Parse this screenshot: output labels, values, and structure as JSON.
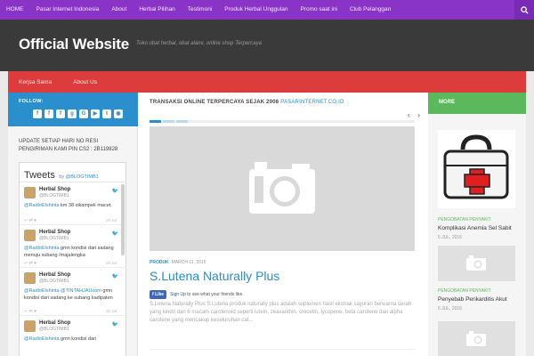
{
  "topnav": {
    "items": [
      "HOME",
      "Pasar Internet Indonesia",
      "About",
      "Herbal Pilihan",
      "Testimoni",
      "Produk Herbal Unggulan",
      "Promo saat ini",
      "Club Pelanggan"
    ]
  },
  "header": {
    "title": "Official Website",
    "tagline": "Toko obat herbal, obat alami, online shop Terpercaya"
  },
  "subnav": {
    "items": [
      "Kerjsa Sama",
      "About Us"
    ]
  },
  "left": {
    "follow_label": "FOLLOW:",
    "social_icons": [
      "facebook-icon",
      "facebook-icon",
      "facebook-icon",
      "google-plus-icon",
      "google-plus-icon",
      "youtube-icon",
      "twitter-icon",
      "rss-icon"
    ],
    "update_text": "UPDATE SETIAP HARI NO RESI PENGIRIMAN KAMI PIN CS2 : 2B119828",
    "tweets_title": "Tweets",
    "tweets_by": "by",
    "tweets_handle": "@BLOGTIMB1",
    "tweets": [
      {
        "name": "Herbal Shop",
        "handle": "@BLOGTIMB1",
        "mention": "@RadioElshinta",
        "text": " km 38 cikampek macet.",
        "time": "20 Jul"
      },
      {
        "name": "Herbal Shop",
        "handle": "@BLOGTIMB1",
        "mention": "@RadioElshinta",
        "text": " gmn kondisi dari sadang menuju subang /majalengka",
        "time": "20 Jul"
      },
      {
        "name": "Herbal Shop",
        "handle": "@BLOGTIMB1",
        "mention": "@RadioElshinta @TINTAHJAUcom",
        "text": " gmn kondisi dari sadang ke subang kadipaten",
        "time": "20 Jul"
      },
      {
        "name": "Herbal Shop",
        "handle": "@BLOGTIMB1",
        "mention": "@RadioElshinta",
        "text": " gmn kondisi dari",
        "time": "20 Jul"
      }
    ]
  },
  "center": {
    "section_heading": "TRANSAKSI ONLINE TERPERCAYA SEJAK 2006",
    "section_site": "PASARINTERNET.CO.ID",
    "post": {
      "category": "PRODUK",
      "date": "MARCH 11, 2015",
      "title": "S.Lutena Naturally Plus",
      "fb_like": "Like",
      "fb_text_link": "Sign Up",
      "fb_text": " to see what your friends like.",
      "excerpt": "S.Lutena Naturally Plus S.Lutena produk naturally plus adalah suplemen hasil ekstrak sayuran berwarna cerah yang kindri dari 6 macam carotenoid seperti lutein, zeaxanthin, crocetin, lycopene, beta carotene dan alpha carotene yang mencakup keseluruhan cat..."
    }
  },
  "right": {
    "more_label": "MORE",
    "posts": [
      {
        "category": "PENGOBATAN PENYAKIT",
        "title": "Komplikasi Anemia Sel Sabit",
        "date": "5 JUL, 2016"
      },
      {
        "category": "PENGOBATAN PENYAKIT",
        "title": "Penyebab Perikarditis Akut",
        "date": "5 JUL, 2016"
      }
    ]
  },
  "colors": {
    "topnav": "#8a34c7",
    "header": "#3a3a3a",
    "subnav": "#dd3c3c",
    "follow": "#2a8fcc",
    "more": "#5cb85c",
    "accent": "#2a8fcc"
  }
}
